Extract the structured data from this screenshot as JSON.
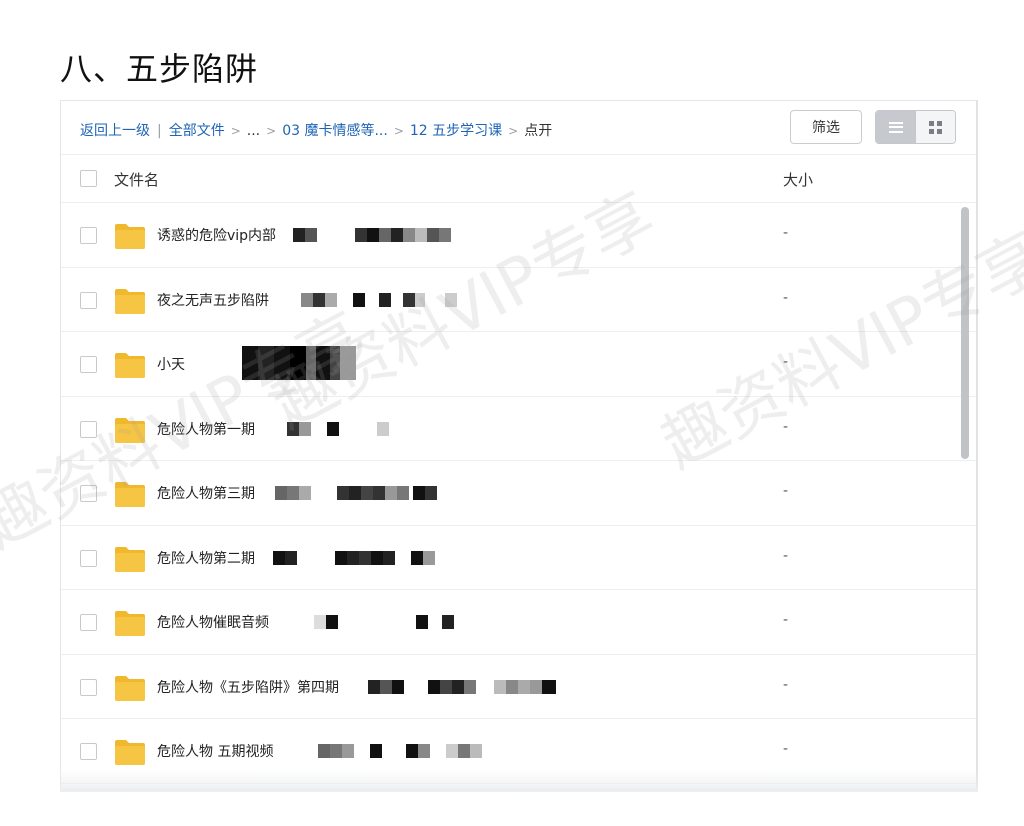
{
  "page": {
    "title": "八、五步陷阱"
  },
  "breadcrumb": {
    "back_label": "返回上一级",
    "separator": "|",
    "all_files_label": "全部文件",
    "ellipsis": "...",
    "arrow": ">",
    "items": [
      "03 魔卡情感等...",
      "12 五步学习课"
    ],
    "current": "点开"
  },
  "toolbar": {
    "filter_label": "筛选"
  },
  "table": {
    "header_name": "文件名",
    "header_size": "大小",
    "rows": [
      {
        "name": "诱惑的危险vip内部",
        "size": "-"
      },
      {
        "name": "夜之无声五步陷阱",
        "size": "-"
      },
      {
        "name": "小天",
        "size": "-"
      },
      {
        "name": "危险人物第一期",
        "size": "-"
      },
      {
        "name": "危险人物第三期",
        "size": "-"
      },
      {
        "name": "危险人物第二期",
        "size": "-"
      },
      {
        "name": "危险人物催眠音频",
        "size": "-"
      },
      {
        "name": "危险人物《五步陷阱》第四期",
        "size": "-"
      },
      {
        "name": "危险人物 五期视频",
        "size": "-"
      }
    ]
  },
  "watermark": {
    "text": "趣资料VIP专享"
  },
  "colors": {
    "link": "#1f64b5",
    "folder": "#f6c543",
    "folder_tab": "#f0b82c",
    "border": "#eceef1"
  },
  "icons": {
    "folder": "folder-icon",
    "list_view": "list-view-icon",
    "grid_view": "grid-view-icon"
  }
}
